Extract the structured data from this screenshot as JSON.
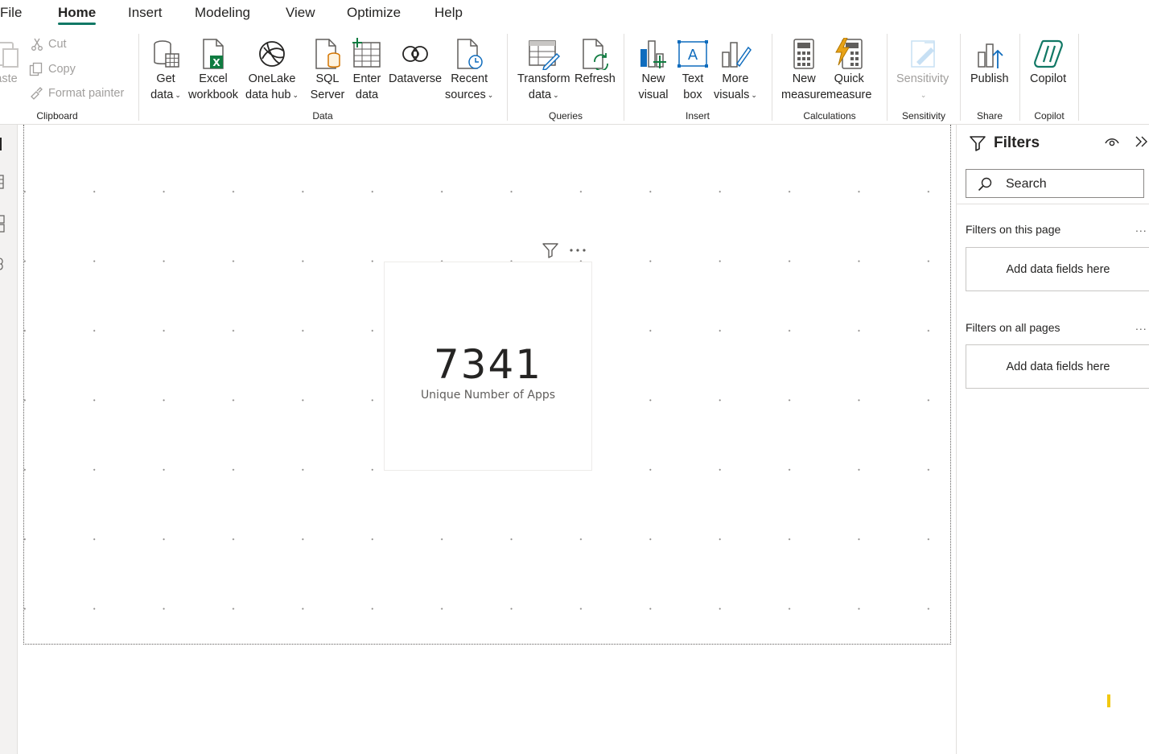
{
  "menu": {
    "tabs": [
      "File",
      "Home",
      "Insert",
      "Modeling",
      "View",
      "Optimize",
      "Help"
    ],
    "active": "Home"
  },
  "ribbon": {
    "clipboard": {
      "paste_label": "aste",
      "cut_label": "Cut",
      "copy_label": "Copy",
      "format_painter_label": "Format painter",
      "group_label": "Clipboard"
    },
    "data": {
      "get_data": [
        "Get",
        "data"
      ],
      "excel": [
        "Excel",
        "workbook"
      ],
      "onelake": [
        "OneLake",
        "data hub"
      ],
      "sql": [
        "SQL",
        "Server"
      ],
      "enter": [
        "Enter",
        "data"
      ],
      "dataverse": [
        "Dataverse",
        ""
      ],
      "recent": [
        "Recent",
        "sources"
      ],
      "group_label": "Data"
    },
    "queries": {
      "transform": [
        "Transform",
        "data"
      ],
      "refresh": [
        "Refresh",
        ""
      ],
      "group_label": "Queries"
    },
    "insert": {
      "new_visual": [
        "New",
        "visual"
      ],
      "text_box": [
        "Text",
        "box"
      ],
      "more_visuals": [
        "More",
        "visuals"
      ],
      "group_label": "Insert"
    },
    "calculations": {
      "new_measure": [
        "New",
        "measure"
      ],
      "quick_measure": [
        "Quick",
        "measure"
      ],
      "group_label": "Calculations"
    },
    "sensitivity": {
      "label": "Sensitivity",
      "group_label": "Sensitivity"
    },
    "share": {
      "publish": "Publish",
      "group_label": "Share"
    },
    "copilot": {
      "label": "Copilot",
      "group_label": "Copilot"
    }
  },
  "card": {
    "value": "7341",
    "label": "Unique Number of Apps"
  },
  "filters": {
    "title": "Filters",
    "search_placeholder": "Search",
    "this_page_label": "Filters on this page",
    "all_pages_label": "Filters on all pages",
    "add_fields_label": "Add data fields here",
    "more": "..."
  },
  "colors": {
    "accent": "#117865",
    "excel_green": "#107c41",
    "quick_measure_orange": "#e8a317",
    "visual_blue": "#0f6cbd"
  }
}
